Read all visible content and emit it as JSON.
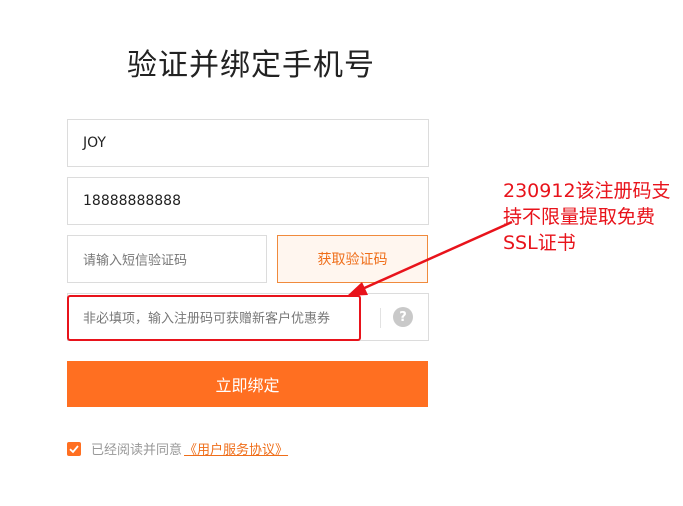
{
  "page": {
    "title": "验证并绑定手机号"
  },
  "form": {
    "username_value": "JOY",
    "phone_value": "18888888888",
    "sms_placeholder": "请输入短信验证码",
    "get_code_label": "获取验证码",
    "coupon_placeholder": "非必填项，输入注册码可获赠新客户优惠券",
    "help_glyph": "?",
    "submit_label": "立即绑定"
  },
  "agreement": {
    "checked": true,
    "text": "已经阅读并同意",
    "link_text": "《用户服务协议》"
  },
  "annotation": {
    "note": "230912该注册码支持不限量提取免费SSL证书",
    "color": "#e8131b"
  },
  "colors": {
    "accent": "#ff6f21",
    "accent_text": "#ef6e1a",
    "highlight": "#e8131b"
  }
}
